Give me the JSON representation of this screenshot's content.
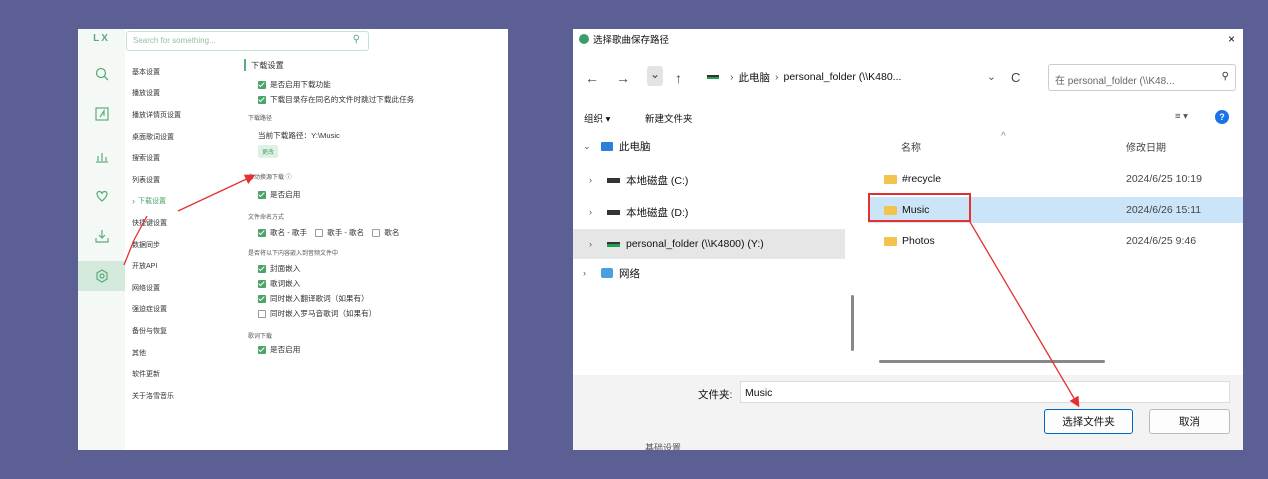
{
  "lx": {
    "logo": "LX",
    "search_placeholder": "Search for something...",
    "nav_icons": [
      "search-icon",
      "music-note-icon",
      "ranking-icon",
      "heart-icon",
      "download-icon",
      "settings-icon"
    ],
    "menu": [
      "基本设置",
      "播放设置",
      "播放详情页设置",
      "桌面歌词设置",
      "搜索设置",
      "列表设置",
      "下载设置",
      "快捷键设置",
      "数据同步",
      "开放API",
      "网络设置",
      "强迫症设置",
      "备份与恢复",
      "其他",
      "软件更新",
      "关于洛雪音乐"
    ],
    "active_menu": "下载设置",
    "section_title": "下载设置",
    "enable_download": "是否启用下载功能",
    "skip_existing": "下载目录存在同名的文件时跳过下载此任务",
    "path_heading": "下载路径",
    "current_path": "当前下载路径：Y:\\Music",
    "change_btn": "更改",
    "auto_switch_heading": "自动换源下载 ⓘ",
    "auto_switch_enabled": "是否启用",
    "naming_heading": "文件命名方式",
    "naming_options": [
      {
        "label": "歌名 - 歌手",
        "checked": true
      },
      {
        "label": "歌手 - 歌名",
        "checked": false
      },
      {
        "label": "歌名",
        "checked": false
      }
    ],
    "embed_heading": "是否将以下内容嵌入到音频文件中",
    "embed_options": [
      {
        "label": "封面嵌入",
        "checked": true
      },
      {
        "label": "歌词嵌入",
        "checked": true
      },
      {
        "label": "同时嵌入翻译歌词（如果有）",
        "checked": true
      },
      {
        "label": "同时嵌入罗马音歌词（如果有）",
        "checked": false
      }
    ],
    "lyric_heading": "歌词下载",
    "lyric_enabled": "是否启用"
  },
  "dialog": {
    "title": "选择歌曲保存路径",
    "close": "×",
    "back": "←",
    "forward": "→",
    "dropdown": "⌄",
    "up": "↑",
    "path_parts": [
      "此电脑",
      "personal_folder (\\\\K480..."
    ],
    "path_chevron": "›",
    "path_dropdown": "⌄",
    "refresh": "C",
    "search_placeholder": "在 personal_folder (\\\\K48...",
    "organize": "组织 ▾",
    "new_folder": "新建文件夹",
    "view": "≡ ▾",
    "help": "?",
    "tree": [
      {
        "label": "此电脑",
        "twisty": "⌄",
        "icon": "computer-icon"
      },
      {
        "label": "本地磁盘 (C:)",
        "twisty": "›",
        "icon": "drive-icon"
      },
      {
        "label": "本地磁盘 (D:)",
        "twisty": "›",
        "icon": "drive-icon"
      },
      {
        "label": "personal_folder (\\\\K4800) (Y:)",
        "twisty": "›",
        "icon": "network-drive-icon",
        "selected": true
      },
      {
        "label": "网络",
        "twisty": "›",
        "icon": "network-icon"
      }
    ],
    "col_name": "名称",
    "col_date": "修改日期",
    "files": [
      {
        "name": "#recycle",
        "date": "2024/6/25 10:19"
      },
      {
        "name": "Music",
        "date": "2024/6/26 15:11",
        "selected": true
      },
      {
        "name": "Photos",
        "date": "2024/6/25 9:46"
      }
    ],
    "folder_label": "文件夹:",
    "folder_value": "Music",
    "select_btn": "选择文件夹",
    "cancel_btn": "取消",
    "behind_text": "基础设置"
  }
}
